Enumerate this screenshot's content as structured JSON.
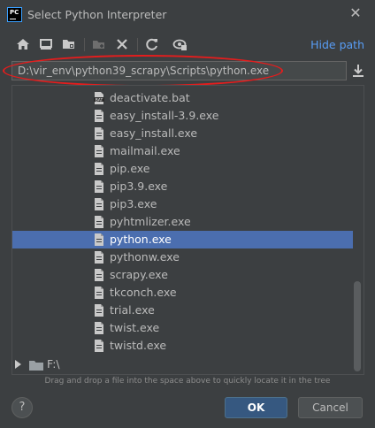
{
  "window": {
    "app_icon_text": "PC",
    "title": "Select Python Interpreter",
    "close_glyph": "✕"
  },
  "toolbar": {
    "icons": [
      "home-icon",
      "desktop-icon",
      "project-folder-icon",
      "new-folder-icon",
      "delete-icon",
      "refresh-icon",
      "show-hidden-icon"
    ],
    "hide_path_label": "Hide path"
  },
  "path": {
    "value": "D:\\vir_env\\python39_scrapy\\Scripts\\python.exe",
    "highlight_color": "#e41d1d"
  },
  "tree": {
    "items": [
      {
        "label": "deactivate.bat",
        "icon": "bat-file-icon"
      },
      {
        "label": "easy_install-3.9.exe",
        "icon": "file-icon"
      },
      {
        "label": "easy_install.exe",
        "icon": "file-icon"
      },
      {
        "label": "mailmail.exe",
        "icon": "file-icon"
      },
      {
        "label": "pip.exe",
        "icon": "file-icon"
      },
      {
        "label": "pip3.9.exe",
        "icon": "file-icon"
      },
      {
        "label": "pip3.exe",
        "icon": "file-icon"
      },
      {
        "label": "pyhtmlizer.exe",
        "icon": "file-icon"
      },
      {
        "label": "python.exe",
        "icon": "file-icon",
        "selected": true
      },
      {
        "label": "pythonw.exe",
        "icon": "file-icon"
      },
      {
        "label": "scrapy.exe",
        "icon": "file-icon"
      },
      {
        "label": "tkconch.exe",
        "icon": "file-icon"
      },
      {
        "label": "trial.exe",
        "icon": "file-icon"
      },
      {
        "label": "twist.exe",
        "icon": "file-icon"
      },
      {
        "label": "twistd.exe",
        "icon": "file-icon"
      }
    ],
    "drive": {
      "label": "F:\\",
      "icon": "drive-folder-icon"
    }
  },
  "hint": "Drag and drop a file into the space above to quickly locate it in the tree",
  "buttons": {
    "help": "?",
    "ok": "OK",
    "cancel": "Cancel"
  },
  "colors": {
    "background": "#3c3f41",
    "selection": "#4b6eaf",
    "link": "#589df6",
    "ok_button": "#365880"
  }
}
